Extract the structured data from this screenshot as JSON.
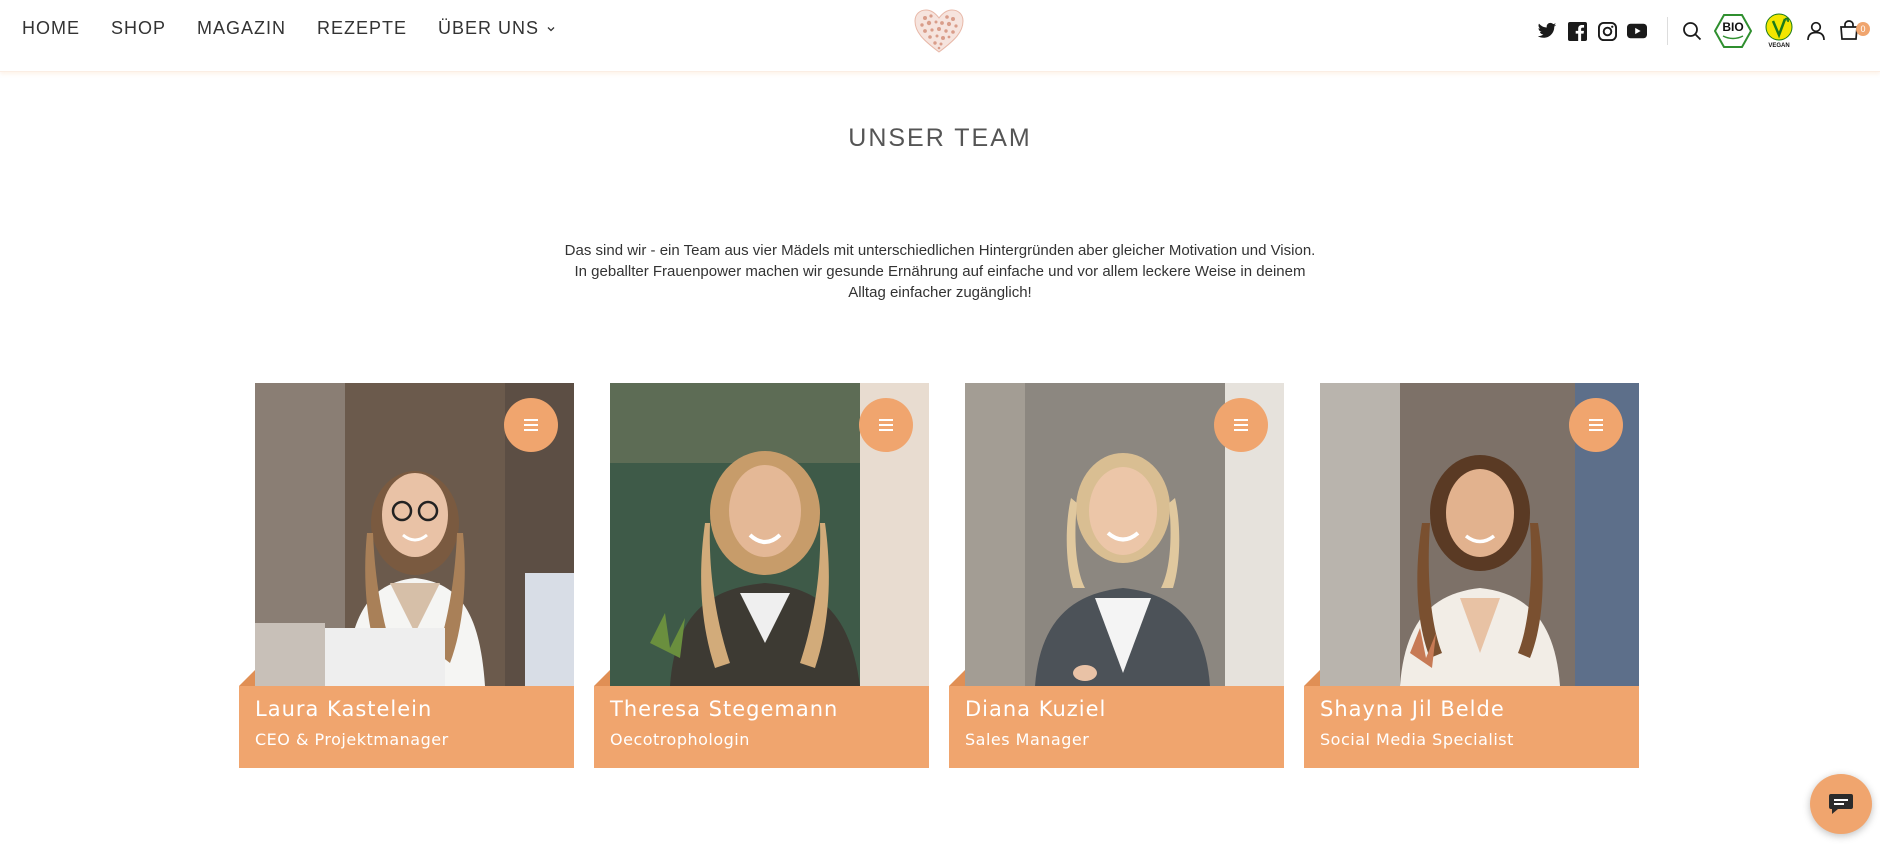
{
  "nav": {
    "items": [
      {
        "label": "HOME"
      },
      {
        "label": "SHOP"
      },
      {
        "label": "MAGAZIN"
      },
      {
        "label": "REZEPTE"
      },
      {
        "label": "ÜBER UNS"
      }
    ]
  },
  "header": {
    "badges": {
      "bio": "BIO",
      "vegan": "VEGAN"
    },
    "cart_count": "0",
    "social_icons": [
      "twitter-icon",
      "facebook-icon",
      "instagram-icon",
      "youtube-icon"
    ]
  },
  "main": {
    "title": "UNSER TEAM",
    "intro": "Das sind wir - ein Team aus vier Mädels mit unterschiedlichen Hintergründen aber gleicher Motivation und Vision. In geballter Frauenpower machen wir gesunde Ernährung auf einfache und vor allem leckere Weise in deinem Alltag einfacher zugänglich!"
  },
  "team": [
    {
      "name": "Laura Kastelein",
      "role": "CEO & Projektmanager"
    },
    {
      "name": "Theresa Stegemann",
      "role": "Oecotrophologin"
    },
    {
      "name": "Diana Kuziel",
      "role": "Sales Manager"
    },
    {
      "name": "Shayna Jil Belde",
      "role": "Social Media Specialist"
    }
  ],
  "colors": {
    "accent": "#f0a56e",
    "text": "#333333",
    "logo": "#e8b8a8"
  }
}
